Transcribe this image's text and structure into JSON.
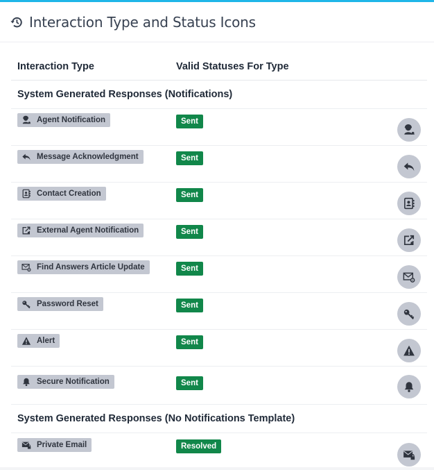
{
  "panel": {
    "title": "Interaction Type and Status Icons",
    "accent_color": "#1fb6e8",
    "header_icon": "history-icon"
  },
  "table": {
    "columns": [
      "Interaction Type",
      "Valid Statuses For Type"
    ],
    "groups": [
      {
        "label": "System Generated Responses (Notifications)",
        "rows": [
          {
            "type": "Agent Notification",
            "status": "Sent",
            "icon": "agent-notification-icon"
          },
          {
            "type": "Message Acknowledgment",
            "status": "Sent",
            "icon": "reply-icon"
          },
          {
            "type": "Contact Creation",
            "status": "Sent",
            "icon": "contact-book-icon"
          },
          {
            "type": "External Agent Notification",
            "status": "Sent",
            "icon": "external-notification-icon"
          },
          {
            "type": "Find Answers Article Update",
            "status": "Sent",
            "icon": "envelope-gear-icon"
          },
          {
            "type": "Password Reset",
            "status": "Sent",
            "icon": "key-icon"
          },
          {
            "type": "Alert",
            "status": "Sent",
            "icon": "warning-icon"
          },
          {
            "type": "Secure Notification",
            "status": "Sent",
            "icon": "bell-icon"
          }
        ]
      },
      {
        "label": "System Generated Responses (No Notifications Template)",
        "rows": [
          {
            "type": "Private Email",
            "status": "Resolved",
            "icon": "envelope-lock-icon"
          }
        ]
      }
    ]
  },
  "colors": {
    "badge_gray": "#c3c7d1",
    "status_green": "#11874a"
  }
}
